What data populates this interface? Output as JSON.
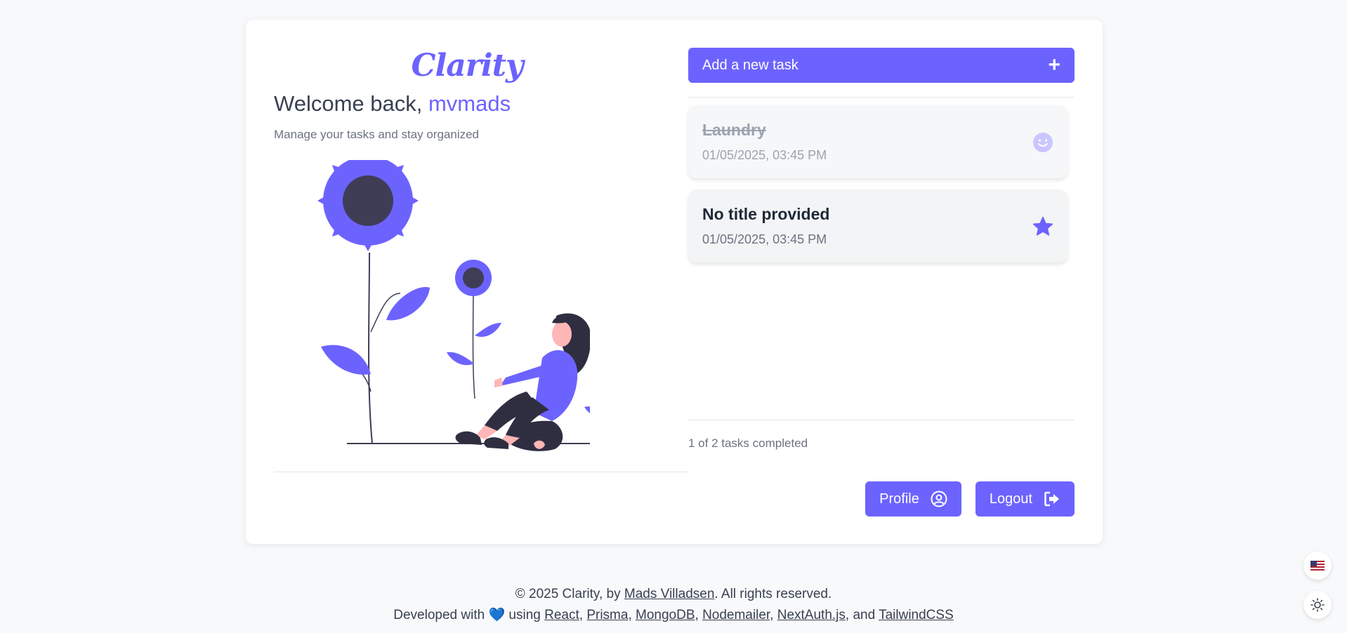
{
  "app": {
    "logo": "Clarity",
    "welcome_prefix": "Welcome back, ",
    "username": "mvmads",
    "subtitle": "Manage your tasks and stay organized"
  },
  "colors": {
    "accent": "#6c63ff",
    "dark": "#3f3d56",
    "skin": "#ffb6b6"
  },
  "add_task": {
    "label": "Add a new task",
    "icon": "plus-icon"
  },
  "tasks": [
    {
      "title": "Laundry",
      "date": "01/05/2025, 03:45 PM",
      "completed": true,
      "icon": "smile-icon"
    },
    {
      "title": "No title provided",
      "date": "01/05/2025, 03:45 PM",
      "completed": false,
      "icon": "star-icon"
    }
  ],
  "progress": {
    "text": "1 of 2 tasks completed",
    "completed": 1,
    "total": 2
  },
  "actions": {
    "profile_label": "Profile",
    "profile_icon": "user-circle-icon",
    "logout_label": "Logout",
    "logout_icon": "logout-icon"
  },
  "footer": {
    "line1_prefix": "© 2025 Clarity, by ",
    "author": "Mads Villadsen",
    "line1_suffix": ". All rights reserved.",
    "line2_prefix": "Developed with ",
    "heart": "💙",
    "line2_using": " using ",
    "tech": [
      "React",
      "Prisma",
      "MongoDB",
      "Nodemailer",
      "NextAuth.js",
      "TailwindCSS"
    ],
    "sep": ", ",
    "and": ", and "
  },
  "floating": {
    "language_icon": "us-flag-icon",
    "theme_icon": "sun-icon"
  }
}
